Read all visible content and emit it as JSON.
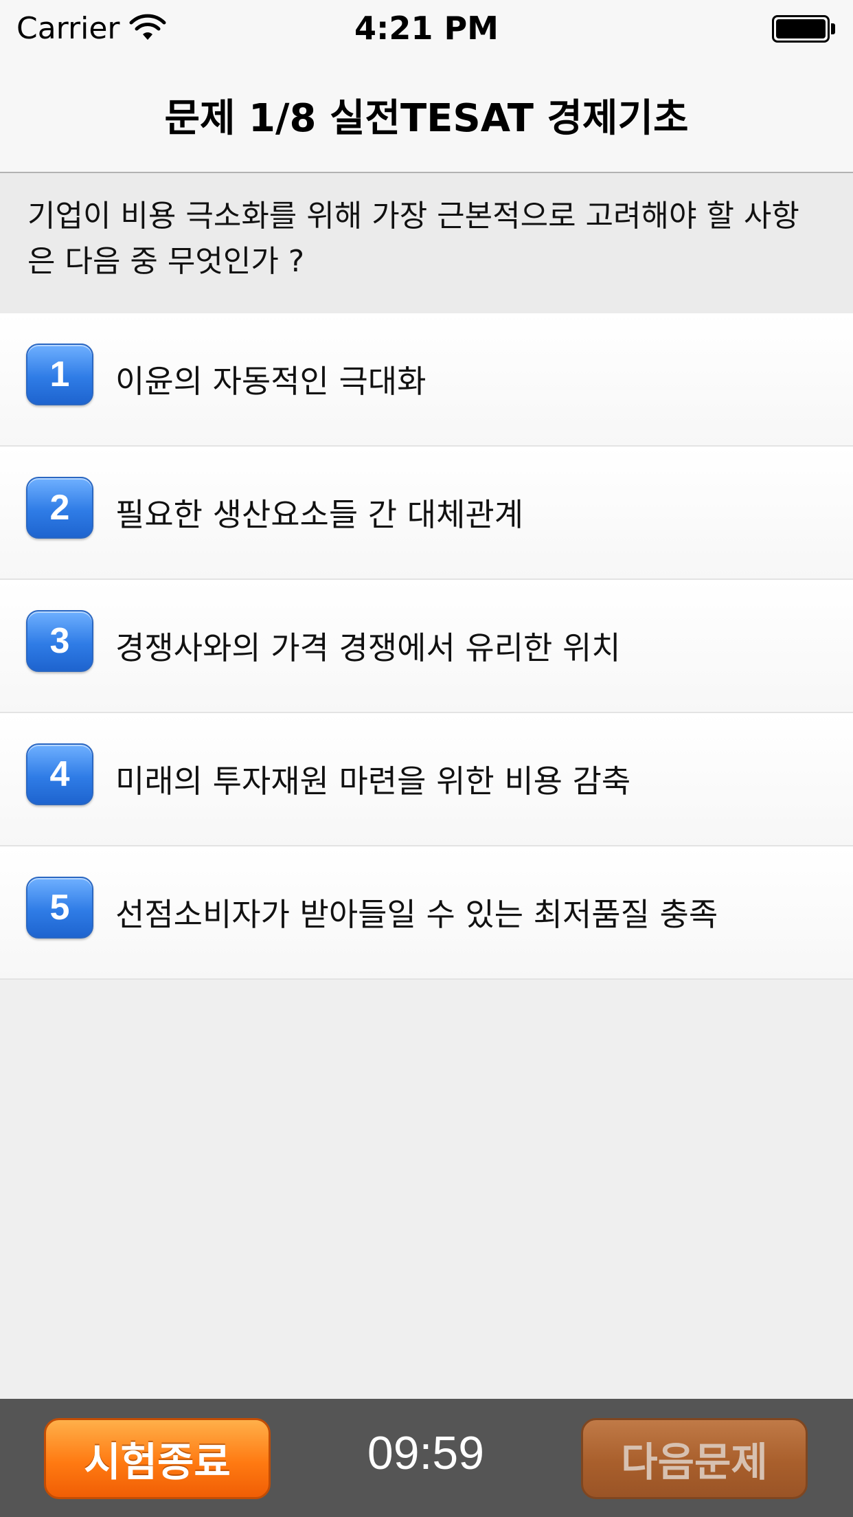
{
  "status_bar": {
    "carrier": "Carrier",
    "time": "4:21 PM",
    "wifi_icon": "wifi-icon",
    "battery_icon": "battery-full-icon"
  },
  "nav": {
    "title": "문제 1/8 실전TESAT 경제기초"
  },
  "question": {
    "text": "기업이 비용 극소화를 위해 가장 근본적으로 고려해야 할 사항은 다음 중 무엇인가 ?"
  },
  "options": [
    {
      "number": "1",
      "text": "이윤의 자동적인 극대화"
    },
    {
      "number": "2",
      "text": "필요한 생산요소들 간 대체관계"
    },
    {
      "number": "3",
      "text": "경쟁사와의 가격 경쟁에서 유리한 위치"
    },
    {
      "number": "4",
      "text": "미래의 투자재원 마련을 위한 비용 감축"
    },
    {
      "number": "5",
      "text": "선점소비자가 받아들일 수 있는 최저품질 충족"
    }
  ],
  "bottom_bar": {
    "end_exam_label": "시험종료",
    "timer": "09:59",
    "next_question_label": "다음문제"
  },
  "colors": {
    "badge_blue": "#2f7ce6",
    "end_button_orange": "#ff7a12",
    "next_button_brown": "#a95f2c",
    "bottom_bar_gray": "#555555"
  }
}
